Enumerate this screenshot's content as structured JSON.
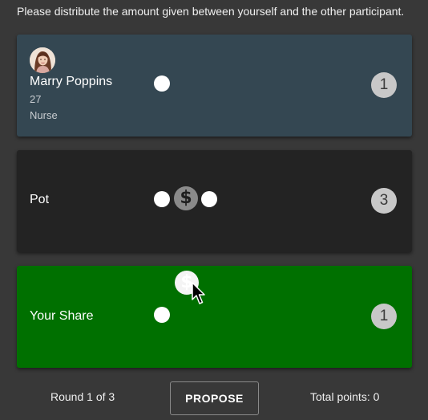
{
  "instructions": "Please distribute the amount given between yourself and the other participant.",
  "participant": {
    "name": "Marry Poppins",
    "age": "27",
    "occupation": "Nurse",
    "coin_count": "1",
    "card_color": "#344752"
  },
  "pot": {
    "label": "Pot",
    "coin_count": "3",
    "card_color": "#232323"
  },
  "your_share": {
    "label": "Your Share",
    "coin_count": "1",
    "card_color": "#007000"
  },
  "coin_symbol": "$",
  "coin_icon": "dollar-coin-icon",
  "footer": {
    "round": "Round 1 of 3",
    "propose_label": "PROPOSE",
    "total_points": "Total points: 0"
  }
}
